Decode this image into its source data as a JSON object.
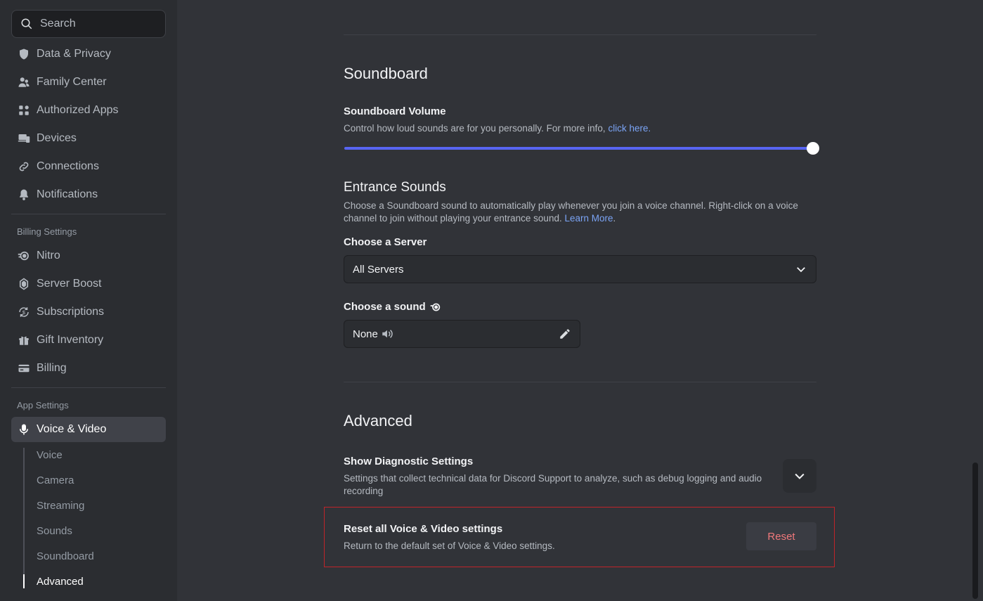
{
  "sidebar": {
    "search_placeholder": "Search",
    "items": [
      {
        "label": "Data & Privacy",
        "icon": "shield-icon"
      },
      {
        "label": "Family Center",
        "icon": "family-icon"
      },
      {
        "label": "Authorized Apps",
        "icon": "apps-icon"
      },
      {
        "label": "Devices",
        "icon": "devices-icon"
      },
      {
        "label": "Connections",
        "icon": "link-icon"
      },
      {
        "label": "Notifications",
        "icon": "bell-icon"
      }
    ],
    "billing_header": "Billing Settings",
    "billing_items": [
      {
        "label": "Nitro",
        "icon": "nitro-icon"
      },
      {
        "label": "Server Boost",
        "icon": "boost-icon"
      },
      {
        "label": "Subscriptions",
        "icon": "subscriptions-icon"
      },
      {
        "label": "Gift Inventory",
        "icon": "gift-icon"
      },
      {
        "label": "Billing",
        "icon": "card-icon"
      }
    ],
    "app_header": "App Settings",
    "active_item": {
      "label": "Voice & Video",
      "icon": "microphone-icon"
    },
    "sub_items": [
      "Voice",
      "Camera",
      "Streaming",
      "Sounds",
      "Soundboard",
      "Advanced"
    ]
  },
  "soundboard": {
    "title": "Soundboard",
    "volume_label": "Soundboard Volume",
    "volume_desc": "Control how loud sounds are for you personally. For more info, ",
    "volume_link": "click here.",
    "volume_level": 1.0
  },
  "entrance": {
    "title": "Entrance Sounds",
    "desc_line1": "Choose a Soundboard sound to automatically play whenever you join a voice channel. Right-click on a voice",
    "desc_line2": "channel to join without playing your entrance sound. ",
    "link": "Learn More",
    "server_label": "Choose a Server",
    "server_value": "All Servers",
    "sound_label": "Choose a sound",
    "sound_value": "None"
  },
  "advanced": {
    "title": "Advanced",
    "diag_label": "Show Diagnostic Settings",
    "diag_desc_line1": "Settings that collect technical data for Discord Support to analyze, such as debug logging and audio",
    "diag_desc_line2": "recording",
    "reset_label": "Reset all Voice & Video settings",
    "reset_desc": "Return to the default set of Voice & Video settings.",
    "reset_button": "Reset"
  },
  "colors": {
    "accent": "#5865f2",
    "danger": "#c0242a",
    "link": "#7ba4f5"
  }
}
